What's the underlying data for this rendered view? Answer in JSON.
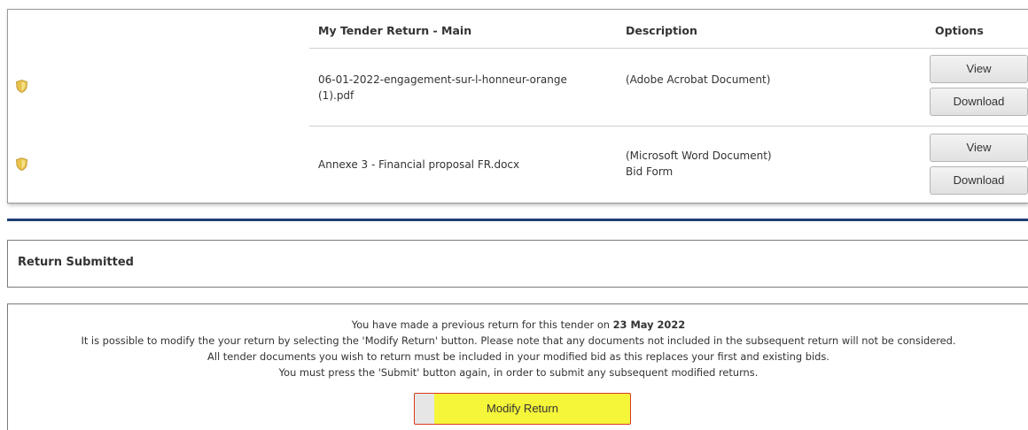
{
  "documents_table": {
    "headers": {
      "name": "My Tender Return - Main",
      "description": "Description",
      "options": "Options"
    },
    "rows": [
      {
        "icon": "shield-icon",
        "filename_line1": "06-01-2022-engagement-sur-l-honneur-orange",
        "filename_line2": "(1).pdf",
        "description_line1": "(Adobe Acrobat Document)",
        "description_line2": "",
        "view_label": "View",
        "download_label": "Download"
      },
      {
        "icon": "shield-icon",
        "filename_line1": "Annexe 3 - Financial proposal FR.docx",
        "filename_line2": "",
        "description_line1": "(Microsoft Word Document)",
        "description_line2": "Bid Form",
        "view_label": "View",
        "download_label": "Download"
      }
    ]
  },
  "return_submitted": {
    "title": "Return Submitted"
  },
  "info": {
    "line1_prefix": "You have made a previous return for this tender on ",
    "line1_date": "23 May 2022",
    "line2": "It is possible to modify the your return by selecting the 'Modify Return' button. Please note that any documents not included in the subsequent return will not be considered.",
    "line3": "All tender documents you wish to return must be included in your modified bid as this replaces your first and existing bids.",
    "line4": "You must press the 'Submit' button again, in order to submit any subsequent modified returns.",
    "modify_label": "Modify Return"
  },
  "colors": {
    "rule": "#1d3f73",
    "modify_bg": "#f5f53a",
    "modify_border": "#d93a1e",
    "shield": "#e8c24a"
  }
}
